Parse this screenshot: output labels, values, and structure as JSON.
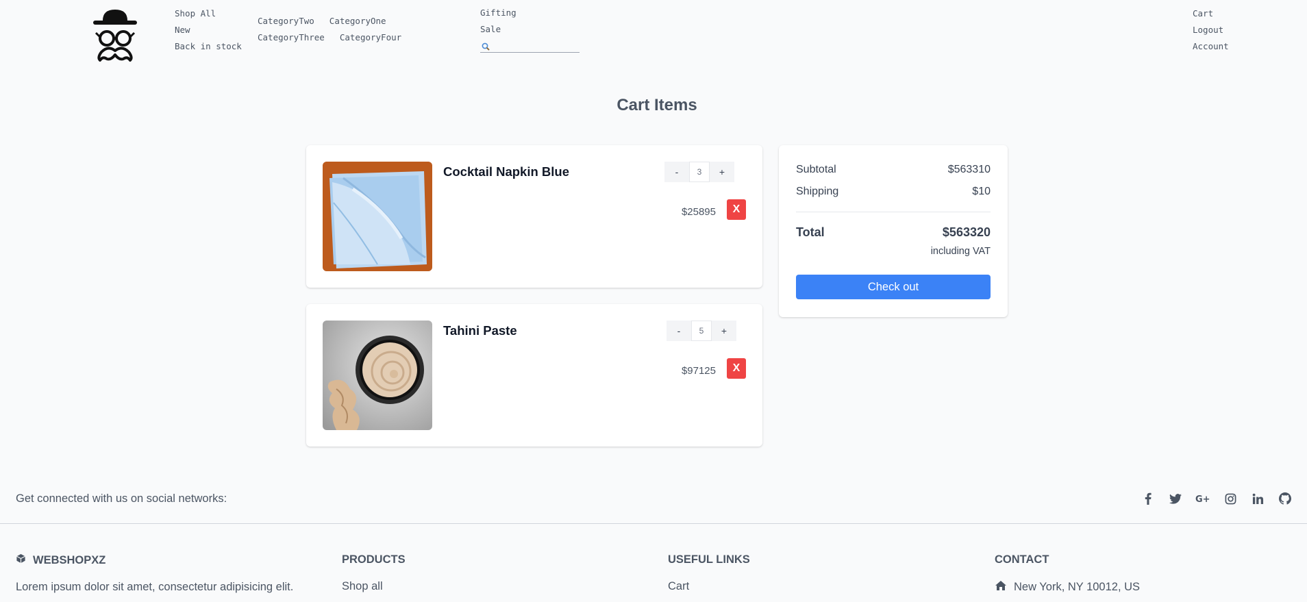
{
  "nav": {
    "col1": [
      "Shop All",
      "New",
      "Back in stock"
    ],
    "categories": [
      "CategoryTwo",
      "CategoryOne",
      "CategoryThree",
      "CategoryFour"
    ],
    "col3": [
      "Gifting",
      "Sale"
    ],
    "search_placeholder": "",
    "right": [
      "Cart",
      "Logout",
      "Account"
    ]
  },
  "page_title": "Cart Items",
  "cart": {
    "items": [
      {
        "name": "Cocktail Napkin Blue",
        "quantity": "3",
        "price": "$25895",
        "remove_label": "X",
        "minus_label": "-",
        "plus_label": "+"
      },
      {
        "name": "Tahini Paste",
        "quantity": "5",
        "price": "$97125",
        "remove_label": "X",
        "minus_label": "-",
        "plus_label": "+"
      }
    ]
  },
  "summary": {
    "subtotal_label": "Subtotal",
    "subtotal_value": "$563310",
    "shipping_label": "Shipping",
    "shipping_value": "$10",
    "total_label": "Total",
    "total_value": "$563320",
    "vat_note": "including VAT",
    "checkout_label": "Check out"
  },
  "social": {
    "text": "Get connected with us on social networks:",
    "icons": [
      "facebook-icon",
      "twitter-icon",
      "google-plus-icon",
      "instagram-icon",
      "linkedin-icon",
      "github-icon"
    ]
  },
  "footer": {
    "brand": "WEBSHOPXZ",
    "brand_text": "Lorem ipsum dolor sit amet, consectetur adipisicing elit.",
    "products_heading": "PRODUCTS",
    "products_link": "Shop all",
    "links_heading": "USEFUL LINKS",
    "links_link": "Cart",
    "contact_heading": "CONTACT",
    "contact_address": "New York, NY 10012, US"
  },
  "colors": {
    "accent": "#3b82f6",
    "danger": "#ef4444",
    "background": "#f9fafb"
  }
}
